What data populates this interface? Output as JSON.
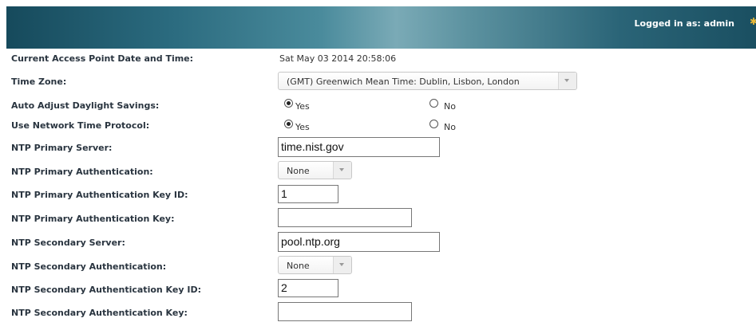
{
  "header": {
    "login_text": "Logged in as: admin"
  },
  "form": {
    "current_datetime": {
      "label": "Current Access Point Date and Time:",
      "value": "Sat May 03 2014 20:58:06"
    },
    "time_zone": {
      "label": "Time Zone:",
      "value": "(GMT) Greenwich Mean Time: Dublin, Lisbon, London"
    },
    "auto_dst": {
      "label": "Auto Adjust Daylight Savings:",
      "yes_label": "Yes",
      "no_label": "No",
      "selected": "Yes"
    },
    "use_ntp": {
      "label": "Use Network Time Protocol:",
      "yes_label": "Yes",
      "no_label": "No",
      "selected": "Yes"
    },
    "ntp_primary_server": {
      "label": "NTP Primary Server:",
      "value": "time.nist.gov"
    },
    "ntp_primary_auth": {
      "label": "NTP Primary Authentication:",
      "value": "None"
    },
    "ntp_primary_key_id": {
      "label": "NTP Primary Authentication Key ID:",
      "value": "1"
    },
    "ntp_primary_key": {
      "label": "NTP Primary Authentication Key:",
      "value": ""
    },
    "ntp_secondary_server": {
      "label": "NTP Secondary Server:",
      "value": "pool.ntp.org"
    },
    "ntp_secondary_auth": {
      "label": "NTP Secondary Authentication:",
      "value": "None"
    },
    "ntp_secondary_key_id": {
      "label": "NTP Secondary Authentication Key ID:",
      "value": "2"
    },
    "ntp_secondary_key": {
      "label": "NTP Secondary Authentication Key:",
      "value": ""
    }
  },
  "colors": {
    "header_dark": "#164a5c",
    "header_light": "#7aaab6",
    "label_text": "#2a3540",
    "star": "#e8b838"
  },
  "icons": {
    "header_star": "star-icon",
    "dropdown_arrow": "chevron-down-icon"
  }
}
